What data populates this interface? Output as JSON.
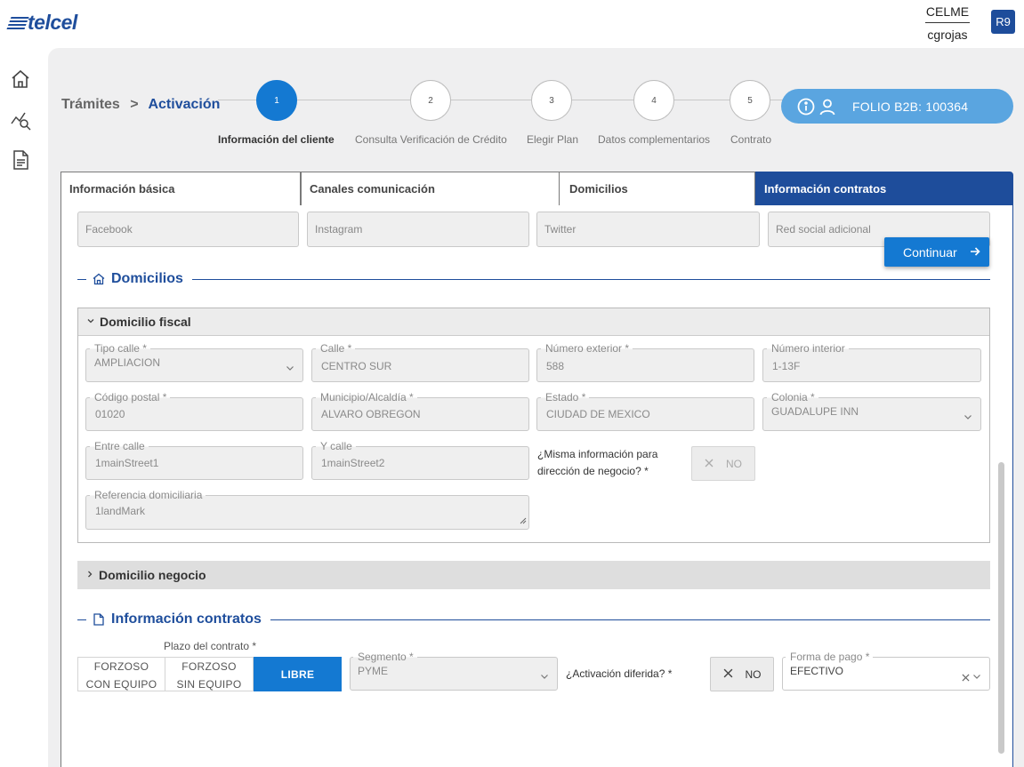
{
  "brand": {
    "logo": "telcel"
  },
  "user": {
    "org": "CELME",
    "username": "cgrojas",
    "avatar": "R9"
  },
  "nav": [
    {
      "icon": "home-icon"
    },
    {
      "icon": "analytics-search-icon"
    },
    {
      "icon": "document-icon"
    }
  ],
  "breadcrumb": {
    "parent": "Trámites",
    "separator": ">",
    "current": "Activación"
  },
  "stepper": {
    "steps": [
      {
        "num": "1",
        "label": "Información del cliente",
        "active": true
      },
      {
        "num": "2",
        "label": "Consulta Verificación de Crédito"
      },
      {
        "num": "3",
        "label": "Elegir Plan"
      },
      {
        "num": "4",
        "label": "Datos complementarios"
      },
      {
        "num": "5",
        "label": "Contrato"
      }
    ]
  },
  "folio": {
    "label": "FOLIO B2B: 100364"
  },
  "tabs": [
    "Información básica",
    "Canales comunicación",
    "Domicilios",
    "Información contratos"
  ],
  "social": {
    "facebook": "Facebook",
    "instagram": "Instagram",
    "twitter": "Twitter",
    "additional": "Red social adicional"
  },
  "continue_button": "Continuar",
  "domicilios": {
    "title": "Domicilios",
    "fiscal": {
      "title": "Domicilio fiscal",
      "tipo_calle": {
        "label": "Tipo calle *",
        "value": "AMPLIACION"
      },
      "calle": {
        "label": "Calle *",
        "value": "CENTRO SUR"
      },
      "num_ext": {
        "label": "Número exterior *",
        "value": "588"
      },
      "num_int": {
        "label": "Número interior",
        "value": "1-13F"
      },
      "cp": {
        "label": "Código postal *",
        "value": "01020"
      },
      "municipio": {
        "label": "Municipio/Alcaldía *",
        "value": "ALVARO OBREGON"
      },
      "estado": {
        "label": "Estado *",
        "value": "CIUDAD DE MEXICO"
      },
      "colonia": {
        "label": "Colonia *",
        "value": "GUADALUPE INN"
      },
      "entre_calle": {
        "label": "Entre calle",
        "value": "1mainStreet1"
      },
      "y_calle": {
        "label": "Y calle",
        "value": "1mainStreet2"
      },
      "misma_info": {
        "question_line1": "¿Misma información para",
        "question_line2": "dirección de negocio? *",
        "value": "NO"
      },
      "referencia": {
        "label": "Referencia domiciliaria",
        "value": "1landMark"
      }
    },
    "negocio": {
      "title": "Domicilio negocio"
    }
  },
  "contratos": {
    "title": "Información contratos",
    "plazo": {
      "label": "Plazo del contrato *",
      "opt1_line1": "FORZOSO",
      "opt1_line2": "CON EQUIPO",
      "opt2_line1": "FORZOSO",
      "opt2_line2": "SIN EQUIPO",
      "opt3": "LIBRE"
    },
    "segmento": {
      "label": "Segmento *",
      "value": "PYME"
    },
    "activacion": {
      "question": "¿Activación diferida? *",
      "value": "NO"
    },
    "forma_pago": {
      "label": "Forma de pago *",
      "value": "EFECTIVO"
    }
  },
  "colors": {
    "brand_blue": "#1e4d9b",
    "accent_blue": "#1479d2",
    "folio_blue": "#5aa5e0"
  }
}
